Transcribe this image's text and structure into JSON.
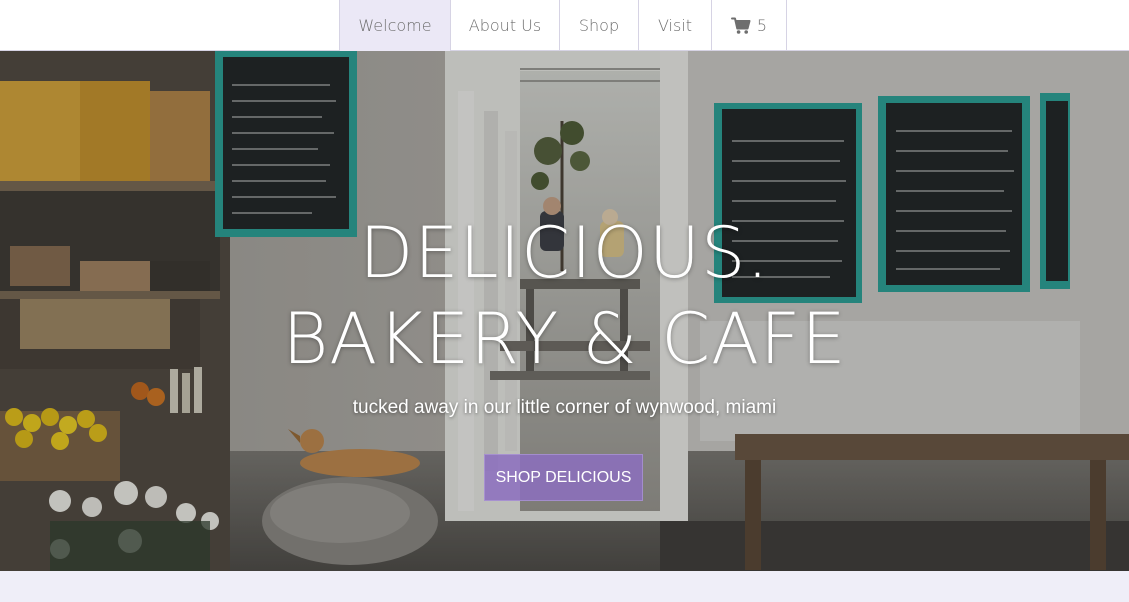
{
  "nav": {
    "items": [
      {
        "label": "Welcome"
      },
      {
        "label": "About Us"
      },
      {
        "label": "Shop"
      },
      {
        "label": "Visit"
      }
    ],
    "cart": {
      "icon": "cart-icon",
      "count": "5"
    }
  },
  "hero": {
    "title_line1": "DELICIOUS.",
    "title_line2": "BAKERY & CAFE",
    "tagline": "tucked away in our little corner of wynwood, miami",
    "cta_label": "SHOP DELICIOUS"
  },
  "colors": {
    "accent": "#8c6ebe",
    "nav_active_bg": "#ebe8f6",
    "footer_band": "#efeef8",
    "chalkboard_frame": "#2aa39a"
  }
}
